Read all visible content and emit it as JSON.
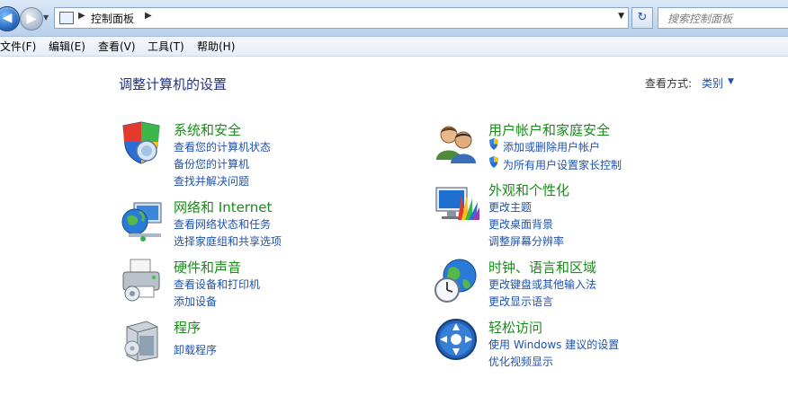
{
  "address": {
    "breadcrumb": "控制面板",
    "search_placeholder": "搜索控制面板"
  },
  "menu": [
    "文件(F)",
    "编辑(E)",
    "查看(V)",
    "工具(T)",
    "帮助(H)"
  ],
  "page": {
    "title": "调整计算机的设置",
    "view_label": "查看方式:",
    "view_value": "类别"
  },
  "categories": [
    {
      "icon": "shield-icon",
      "title": "系统和安全",
      "links": [
        "查看您的计算机状态",
        "备份您的计算机",
        "查找并解决问题"
      ]
    },
    {
      "icon": "network-globe-icon",
      "title": "网络和 Internet",
      "links": [
        "查看网络状态和任务",
        "选择家庭组和共享选项"
      ]
    },
    {
      "icon": "printer-icon",
      "title": "硬件和声音",
      "links": [
        "查看设备和打印机",
        "添加设备"
      ]
    },
    {
      "icon": "programs-box-icon",
      "title": "程序",
      "links": [
        "卸载程序"
      ]
    },
    {
      "icon": "users-icon",
      "title": "用户帐户和家庭安全",
      "links": [
        "添加或删除用户帐户",
        "为所有用户设置家长控制"
      ]
    },
    {
      "icon": "appearance-monitor-icon",
      "title": "外观和个性化",
      "links": [
        "更改主题",
        "更改桌面背景",
        "调整屏幕分辨率"
      ]
    },
    {
      "icon": "clock-globe-icon",
      "title": "时钟、语言和区域",
      "links": [
        "更改键盘或其他输入法",
        "更改显示语言"
      ]
    },
    {
      "icon": "ease-of-access-icon",
      "title": "轻松访问",
      "links": [
        "使用 Windows 建议的设置",
        "优化视频显示"
      ]
    }
  ],
  "colors": {
    "title_green": "#198c19",
    "link_blue": "#1e52b0",
    "heading_blue": "#1e3287"
  }
}
